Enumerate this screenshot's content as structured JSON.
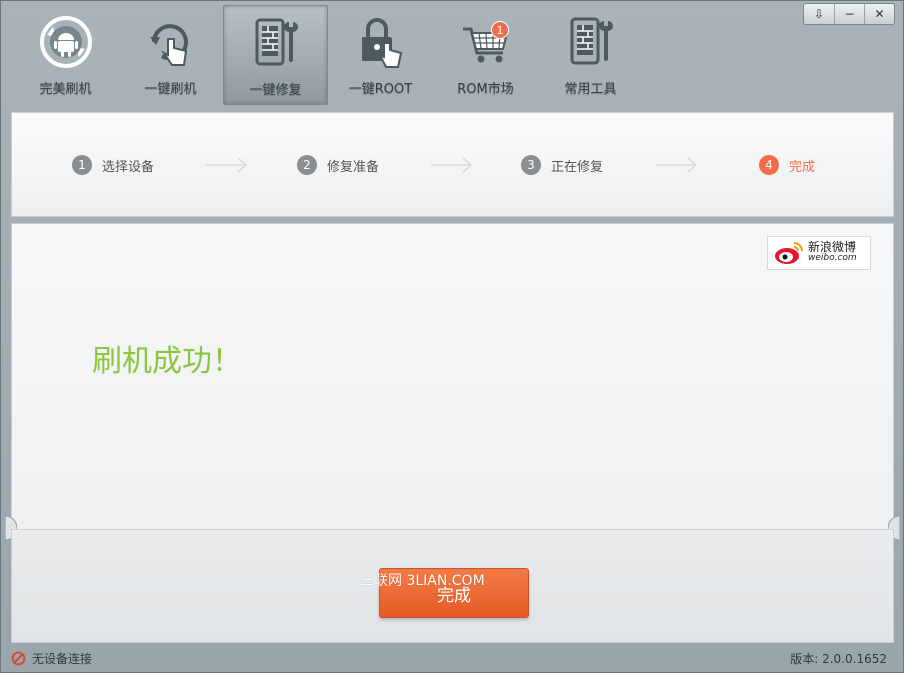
{
  "window": {
    "controls": {
      "menu": "⇩",
      "minimize": "−",
      "close": "✕"
    }
  },
  "toolbar": {
    "items": [
      {
        "label": "完美刷机",
        "icon": "android-refresh-icon"
      },
      {
        "label": "一键刷机",
        "icon": "refresh-hand-icon"
      },
      {
        "label": "一键修复",
        "icon": "phone-wrench-icon",
        "active": true
      },
      {
        "label": "一键ROOT",
        "icon": "lock-hand-icon"
      },
      {
        "label": "ROM市场",
        "icon": "cart-icon",
        "badge": "1"
      },
      {
        "label": "常用工具",
        "icon": "tools-icon"
      }
    ]
  },
  "steps": [
    {
      "num": "1",
      "label": "选择设备"
    },
    {
      "num": "2",
      "label": "修复准备"
    },
    {
      "num": "3",
      "label": "正在修复"
    },
    {
      "num": "4",
      "label": "完成",
      "current": true
    }
  ],
  "main": {
    "weibo_cn": "新浪微博",
    "weibo_en": "weibo.com",
    "success_text": "刷机成功！",
    "done_button": "完成",
    "watermark": "三联网 3LIAN.COM"
  },
  "status": {
    "device": "无设备连接",
    "version": "版本: 2.0.0.1652"
  },
  "colors": {
    "accent": "#f36b47",
    "success": "#8cc63f",
    "button": "#e8602c"
  }
}
